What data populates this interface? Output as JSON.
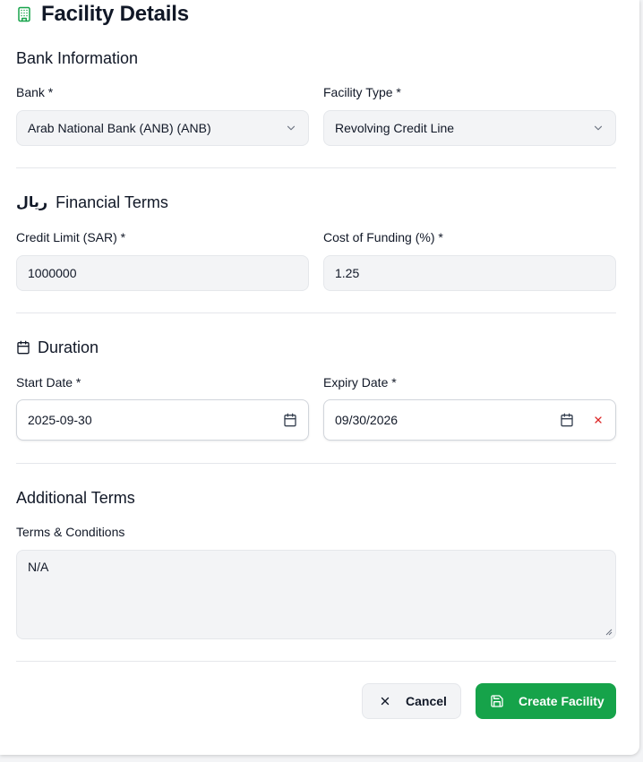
{
  "header": {
    "title": "Facility Details",
    "icon": "building-icon"
  },
  "bank_information": {
    "heading": "Bank Information",
    "bank": {
      "label": "Bank *",
      "value": "Arab National Bank (ANB) (ANB)"
    },
    "facility_type": {
      "label": "Facility Type *",
      "value": "Revolving Credit Line"
    }
  },
  "financial_terms": {
    "heading": "Financial Terms",
    "icon_text": "ريال",
    "credit_limit": {
      "label": "Credit Limit (SAR) *",
      "value": "1000000"
    },
    "cost_of_funding": {
      "label": "Cost of Funding (%) *",
      "value": "1.25"
    }
  },
  "duration": {
    "heading": "Duration",
    "start_date": {
      "label": "Start Date *",
      "value": "2025-09-30"
    },
    "expiry_date": {
      "label": "Expiry Date *",
      "value": "09/30/2026"
    }
  },
  "additional_terms": {
    "heading": "Additional Terms",
    "terms": {
      "label": "Terms & Conditions",
      "value": "N/A"
    }
  },
  "actions": {
    "cancel_label": "Cancel",
    "create_label": "Create Facility"
  },
  "colors": {
    "accent": "#16a34a",
    "danger": "#dc2626",
    "field_bg": "#f3f4f6"
  }
}
